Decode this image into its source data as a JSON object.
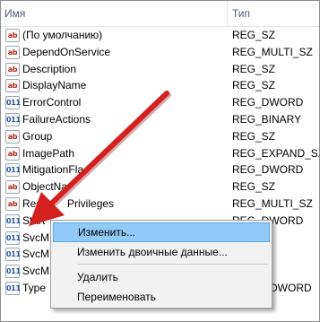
{
  "header": {
    "name_col": "Имя",
    "type_col": "Тип"
  },
  "rows": [
    {
      "name": "(По умолчанию)",
      "type": "REG_SZ",
      "icon": "string-value-icon"
    },
    {
      "name": "DependOnService",
      "type": "REG_MULTI_SZ",
      "icon": "string-value-icon"
    },
    {
      "name": "Description",
      "type": "REG_SZ",
      "icon": "string-value-icon"
    },
    {
      "name": "DisplayName",
      "type": "REG_SZ",
      "icon": "string-value-icon"
    },
    {
      "name": "ErrorControl",
      "type": "REG_DWORD",
      "icon": "binary-value-icon"
    },
    {
      "name": "FailureActions",
      "type": "REG_BINARY",
      "icon": "binary-value-icon"
    },
    {
      "name": "Group",
      "type": "REG_SZ",
      "icon": "string-value-icon"
    },
    {
      "name": "ImagePath",
      "type": "REG_EXPAND_SZ",
      "icon": "string-value-icon"
    },
    {
      "name": "MitigationFla",
      "type": "REG_DWORD",
      "icon": "binary-value-icon"
    },
    {
      "name": "ObjectNa",
      "type": "REG_SZ",
      "icon": "string-value-icon"
    },
    {
      "name": "Req",
      "name_tail": "Privileges",
      "type": "REG_MULTI_SZ",
      "icon": "string-value-icon"
    },
    {
      "name": "Start",
      "type": "REG_DWORD",
      "icon": "binary-value-icon"
    },
    {
      "name": "SvcM",
      "type": "",
      "icon": "binary-value-icon"
    },
    {
      "name": "SvcM",
      "type": "",
      "icon": "binary-value-icon"
    },
    {
      "name": "SvcM",
      "type": "",
      "icon": "binary-value-icon"
    },
    {
      "name": "Type",
      "type": "DWORD",
      "icon": "binary-value-icon"
    }
  ],
  "icons": {
    "sz_glyph": "ab",
    "bin_glyph": "011"
  },
  "context_menu": {
    "items": [
      {
        "label": "Изменить...",
        "highlighted": true
      },
      {
        "label": "Изменить двоичные данные..."
      },
      {
        "label": "Удалить"
      },
      {
        "label": "Переименовать"
      }
    ]
  },
  "colors": {
    "arrow": "#d4201e",
    "menu_highlight": "#91c9f7",
    "header_text": "#4c607a"
  }
}
